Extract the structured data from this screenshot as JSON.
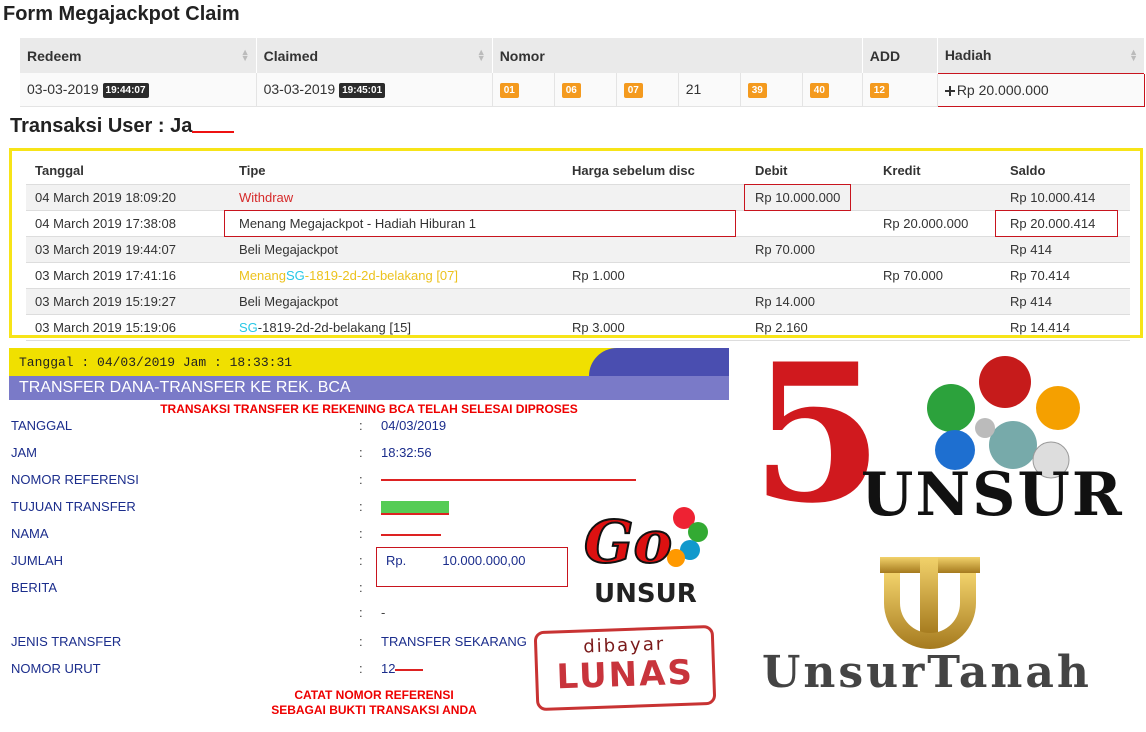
{
  "claim": {
    "title": "Form Megajackpot Claim",
    "headers": [
      "Redeem",
      "Claimed",
      "Nomor",
      "ADD",
      "Hadiah"
    ],
    "row": {
      "redeem_date": "03-03-2019",
      "redeem_time": "19:44:07",
      "claimed_date": "03-03-2019",
      "claimed_time": "19:45:01",
      "numbers": [
        "01",
        "06",
        "07",
        "21",
        "39",
        "40"
      ],
      "add": "12",
      "hadiah": "Rp 20.000.000"
    },
    "colors": {
      "ball": "#f49a1e",
      "highlight_box": "#c8141e"
    }
  },
  "transaksi": {
    "title": "Transaksi User : Ja",
    "headers": [
      "Tanggal",
      "Tipe",
      "Harga sebelum disc",
      "Debit",
      "Kredit",
      "Saldo"
    ],
    "rows": [
      {
        "tanggal": "04 March 2019 18:09:20",
        "tipe": "Withdraw",
        "harga": "",
        "debit": "Rp 10.000.000",
        "kredit": "",
        "saldo": "Rp 10.000.414"
      },
      {
        "tanggal": "04 March 2019 17:38:08",
        "tipe": "Menang Megajackpot - Hadiah Hiburan 1",
        "harga": "",
        "debit": "",
        "kredit": "Rp 20.000.000",
        "saldo": "Rp 20.000.414"
      },
      {
        "tanggal": "03 March 2019 19:44:07",
        "tipe": "Beli Megajackpot",
        "harga": "",
        "debit": "Rp 70.000",
        "kredit": "",
        "saldo": "Rp 414"
      },
      {
        "tanggal": "03 March 2019 17:41:16",
        "tipe_a": "Menang",
        "tipe_b": "SG",
        "tipe_c": "-1819-2d-2d-belakang [07]",
        "harga": "Rp 1.000",
        "debit": "",
        "kredit": "Rp 70.000",
        "saldo": "Rp 70.414"
      },
      {
        "tanggal": "03 March 2019 15:19:27",
        "tipe": "Beli Megajackpot",
        "harga": "",
        "debit": "Rp 14.000",
        "kredit": "",
        "saldo": "Rp 414"
      },
      {
        "tanggal": "03 March 2019 15:19:06",
        "tipe_b": "SG",
        "tipe_c": "-1819-2d-2d-belakang [15]",
        "harga": "Rp 3.000",
        "debit": "Rp 2.160",
        "kredit": "",
        "saldo": "Rp 14.414"
      }
    ],
    "colors": {
      "panel_border": "#f7e418",
      "withdraw": "#d62a2a",
      "menang": "#ecc21d",
      "sg": "#29c8e6"
    }
  },
  "bca": {
    "header": "Tanggal : 04/03/2019 Jam : 18:33:31",
    "band": "TRANSFER DANA-TRANSFER KE REK. BCA",
    "notice": "TRANSAKSI TRANSFER KE REKENING BCA TELAH SELESAI DIPROSES",
    "fields": [
      {
        "label": "TANGGAL",
        "value": "04/03/2019"
      },
      {
        "label": "JAM",
        "value": "18:32:56"
      },
      {
        "label": "NOMOR REFERENSI",
        "value": ""
      },
      {
        "label": "TUJUAN TRANSFER",
        "value": ""
      },
      {
        "label": "NAMA",
        "value": ""
      },
      {
        "label": "JUMLAH",
        "value": "Rp.          10.000.000,00"
      },
      {
        "label": "BERITA",
        "value": ""
      },
      {
        "label": "",
        "value": "-"
      },
      {
        "label": "JENIS TRANSFER",
        "value": "TRANSFER SEKARANG"
      },
      {
        "label": "NOMOR URUT",
        "value": "12"
      }
    ],
    "footer_1": "CATAT NOMOR REFERENSI",
    "footer_2": "SEBAGAI BUKTI TRANSAKSI ANDA",
    "colors": {
      "header_bg": "#f0e000",
      "band_bg": "#7a7ac8",
      "label": "#1b2d8c",
      "notice": "#e00000"
    }
  },
  "logos": {
    "go_unsur": {
      "text_a": "Go",
      "text_b": "UNSUR"
    },
    "lunas": {
      "line1": "dibayar",
      "line2": "LUNAS"
    },
    "five_unsur": {
      "num": "5",
      "word": "UNSUR"
    },
    "unsur_tanah": {
      "word": "UnsurTanah"
    }
  }
}
